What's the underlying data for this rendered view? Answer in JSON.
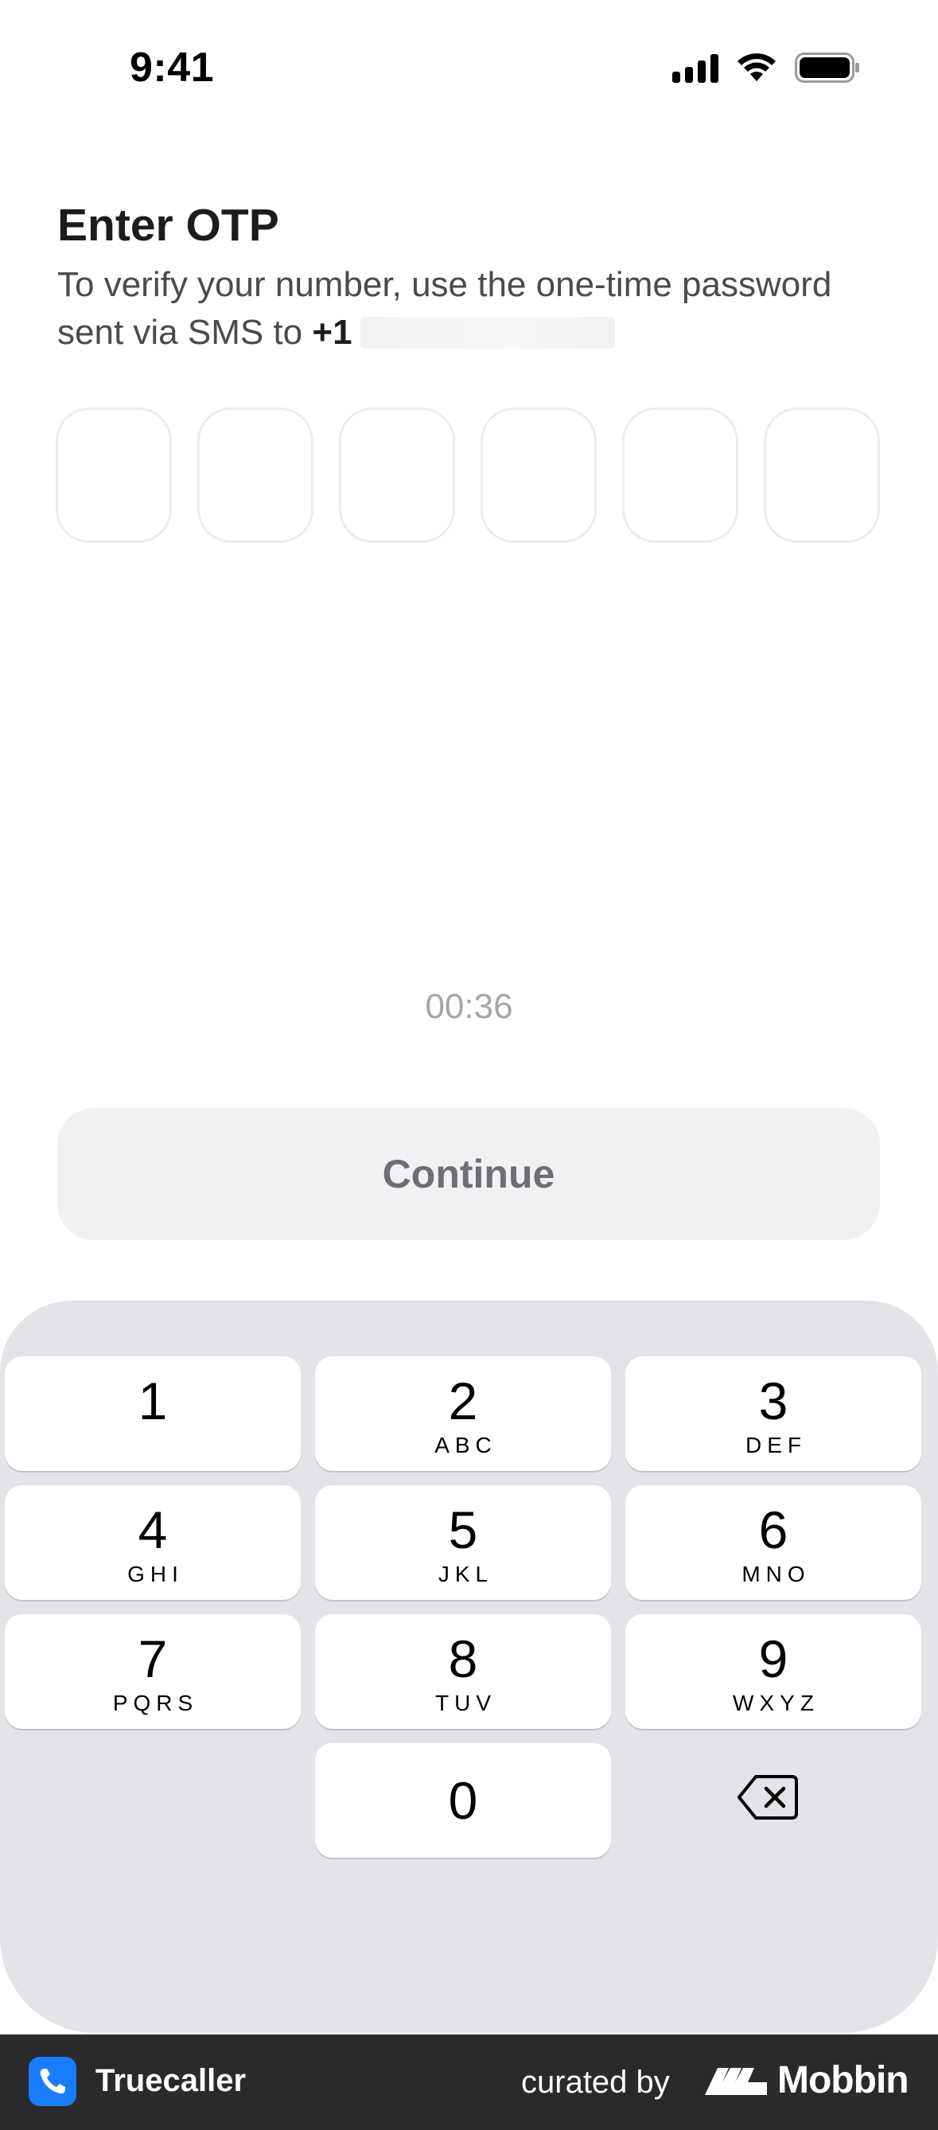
{
  "status_bar": {
    "time": "9:41"
  },
  "header": {
    "title": "Enter OTP",
    "subtitle_line1": "To verify your number, use the one-time password",
    "subtitle_line2_prefix": "sent via SMS to",
    "country_code": "+1"
  },
  "otp": {
    "digits": [
      "",
      "",
      "",
      "",
      "",
      ""
    ]
  },
  "timer": "00:36",
  "continue_label": "Continue",
  "keypad": {
    "keys": [
      {
        "digit": "1",
        "letters": ""
      },
      {
        "digit": "2",
        "letters": "ABC"
      },
      {
        "digit": "3",
        "letters": "DEF"
      },
      {
        "digit": "4",
        "letters": "GHI"
      },
      {
        "digit": "5",
        "letters": "JKL"
      },
      {
        "digit": "6",
        "letters": "MNO"
      },
      {
        "digit": "7",
        "letters": "PQRS"
      },
      {
        "digit": "8",
        "letters": "TUV"
      },
      {
        "digit": "9",
        "letters": "WXYZ"
      },
      {
        "digit": "0",
        "letters": ""
      }
    ],
    "delete_icon": "delete-left-icon"
  },
  "footer": {
    "app_name": "Truecaller",
    "curated_by": "curated by",
    "brand": "Mobbin"
  },
  "colors": {
    "button_bg": "#f0f1f2",
    "keypad_bg": "#e3e4e7",
    "footer_bg": "#2a2a2c",
    "truecaller_blue": "#1a7cff"
  }
}
